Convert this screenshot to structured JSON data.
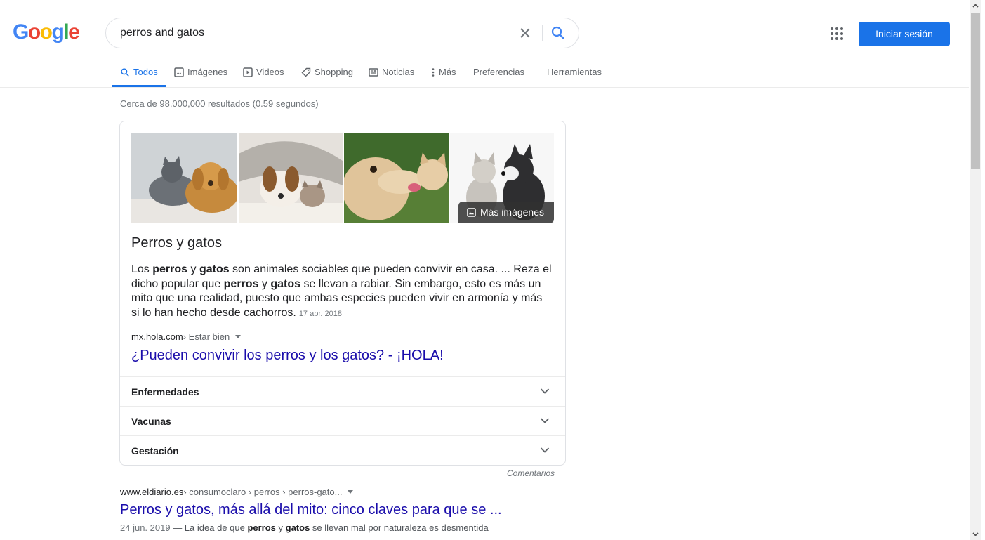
{
  "header": {
    "logo_letters": [
      "G",
      "o",
      "o",
      "g",
      "l",
      "e"
    ],
    "search_value": "perros and gatos",
    "signin_label": "Iniciar sesión"
  },
  "tabs": [
    {
      "label": "Todos",
      "icon": "search-icon",
      "active": true
    },
    {
      "label": "Imágenes",
      "icon": "image-icon"
    },
    {
      "label": "Videos",
      "icon": "play-icon"
    },
    {
      "label": "Shopping",
      "icon": "tag-icon"
    },
    {
      "label": "Noticias",
      "icon": "news-icon"
    },
    {
      "label": "Más",
      "icon": "more-vert-icon"
    },
    {
      "label": "Preferencias"
    },
    {
      "label": "Herramientas"
    }
  ],
  "result_stats": "Cerca de 98,000,000 resultados (0.59 segundos)",
  "featured": {
    "more_images_label": "Más imágenes",
    "title": "Perros y gatos",
    "snippet_parts": [
      {
        "t": "Los "
      },
      {
        "t": "perros",
        "b": true
      },
      {
        "t": " y "
      },
      {
        "t": "gatos",
        "b": true
      },
      {
        "t": " son animales sociables que pueden convivir en casa. ... Reza el dicho popular que "
      },
      {
        "t": "perros",
        "b": true
      },
      {
        "t": " y "
      },
      {
        "t": "gatos",
        "b": true
      },
      {
        "t": " se llevan a rabiar. Sin embargo, esto es más un mito que una realidad, puesto que ambas especies pueden vivir en armonía y más si lo han hecho desde cachorros."
      }
    ],
    "date": "17 abr. 2018",
    "cite_domain": "mx.hola.com",
    "cite_path": " › Estar bien",
    "link_title": "¿Pueden convivir los perros y los gatos? - ¡HOLA!",
    "accordion": [
      "Enfermedades",
      "Vacunas",
      "Gestación"
    ],
    "feedback": "Comentarios"
  },
  "result2": {
    "cite_domain": "www.eldiario.es",
    "cite_path": " › consumoclaro › perros › perros-gato...",
    "title": "Perros y gatos, más allá del mito: cinco claves para que se ...",
    "date": "24 jun. 2019",
    "snippet_parts": [
      {
        "t": " — La idea de que "
      },
      {
        "t": "perros",
        "b": true
      },
      {
        "t": " y "
      },
      {
        "t": "gatos",
        "b": true
      },
      {
        "t": " se llevan mal por naturaleza es desmentida"
      }
    ]
  },
  "colors": {
    "accent": "#1a73e8",
    "link": "#1a0dab",
    "logo": [
      "#4285f4",
      "#ea4335",
      "#fbbc05",
      "#4285f4",
      "#34a853",
      "#ea4335"
    ]
  }
}
